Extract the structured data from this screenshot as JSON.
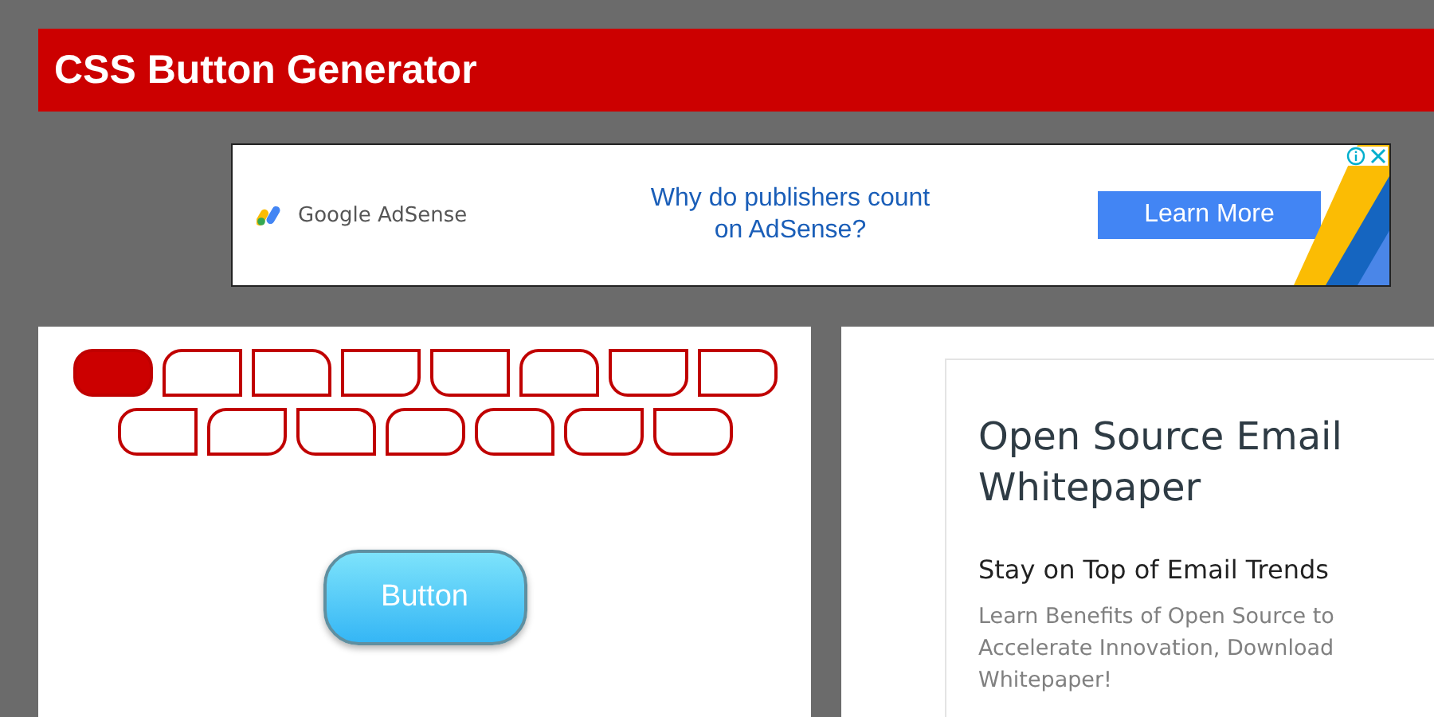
{
  "header": {
    "title": "CSS Button Generator"
  },
  "banner_ad": {
    "brand": "Google AdSense",
    "headline": "Why do publishers count on AdSense?",
    "cta": "Learn More"
  },
  "shape_presets": [
    {
      "kind": "all",
      "selected": true
    },
    {
      "kind": "tl",
      "selected": false
    },
    {
      "kind": "tr",
      "selected": false
    },
    {
      "kind": "br",
      "selected": false
    },
    {
      "kind": "bl",
      "selected": false
    },
    {
      "kind": "top",
      "selected": false
    },
    {
      "kind": "bottom",
      "selected": false
    },
    {
      "kind": "right",
      "selected": false
    },
    {
      "kind": "left",
      "selected": false
    },
    {
      "kind": "tlbr",
      "selected": false
    },
    {
      "kind": "trbl",
      "selected": false
    },
    {
      "kind": "notbl",
      "selected": false
    },
    {
      "kind": "notbr",
      "selected": false
    },
    {
      "kind": "nottr",
      "selected": false
    },
    {
      "kind": "nottl",
      "selected": false
    }
  ],
  "preview": {
    "button_label": "Button"
  },
  "side_ad": {
    "title": "Open Source Email Whitepaper",
    "subtitle": "Stay on Top of Email Trends",
    "body": "Learn Benefits of Open Source to Accelerate Innovation, Download Whitepaper!"
  }
}
